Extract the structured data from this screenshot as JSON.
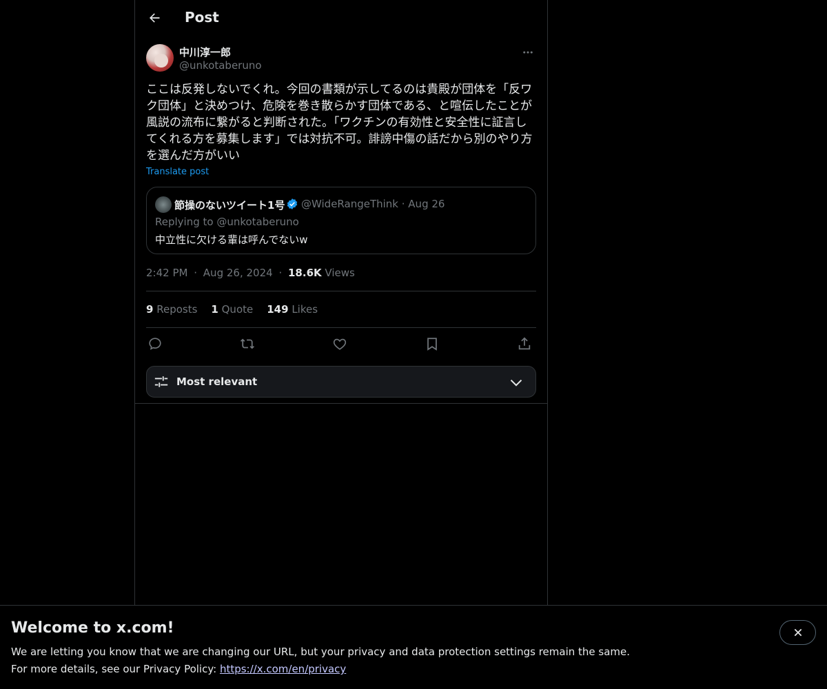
{
  "header": {
    "title": "Post"
  },
  "author": {
    "display_name": "中川淳一郎",
    "handle": "@unkotaberuno"
  },
  "post": {
    "text": "ここは反発しないでくれ。今回の書類が示してるのは貴殿が団体を「反ワ\nク団体」と決めつけ、危険を巻き散らかす団体である、と喧伝したことが\n風説の流布に繋がると判断された。「ワクチンの有効性と安全性に証言し\nてくれる方を募集します」では対抗不可。誹謗中傷の話だから別のやり方\nを選んだ方がいい",
    "translate_label": "Translate post"
  },
  "quote": {
    "display_name": "節操のないツイート1号",
    "handle_date": "@WideRangeThink · Aug 26",
    "replying_to": "Replying to @unkotaberuno",
    "text": "中立性に欠ける輩は呼んでないw"
  },
  "meta": {
    "time": "2:42 PM",
    "sep1": "·",
    "date": "Aug 26, 2024",
    "sep2": "·",
    "views_count": "18.6K",
    "views_label": "Views"
  },
  "stats": {
    "reposts_count": "9",
    "reposts_label": "Reposts",
    "quotes_count": "1",
    "quotes_label": "Quote",
    "likes_count": "149",
    "likes_label": "Likes"
  },
  "sort": {
    "label": "Most relevant"
  },
  "banner": {
    "title": "Welcome to x.com!",
    "line1": "We are letting you know that we are changing our URL, but your privacy and data protection settings remain the same.",
    "line2_prefix": "For more details, see our Privacy Policy: ",
    "link": "https://x.com/en/privacy"
  },
  "colors": {
    "accent": "#1d9bf0",
    "text": "#e7e9ea",
    "muted": "#71767b",
    "border": "#2f3336",
    "background": "#000000"
  }
}
